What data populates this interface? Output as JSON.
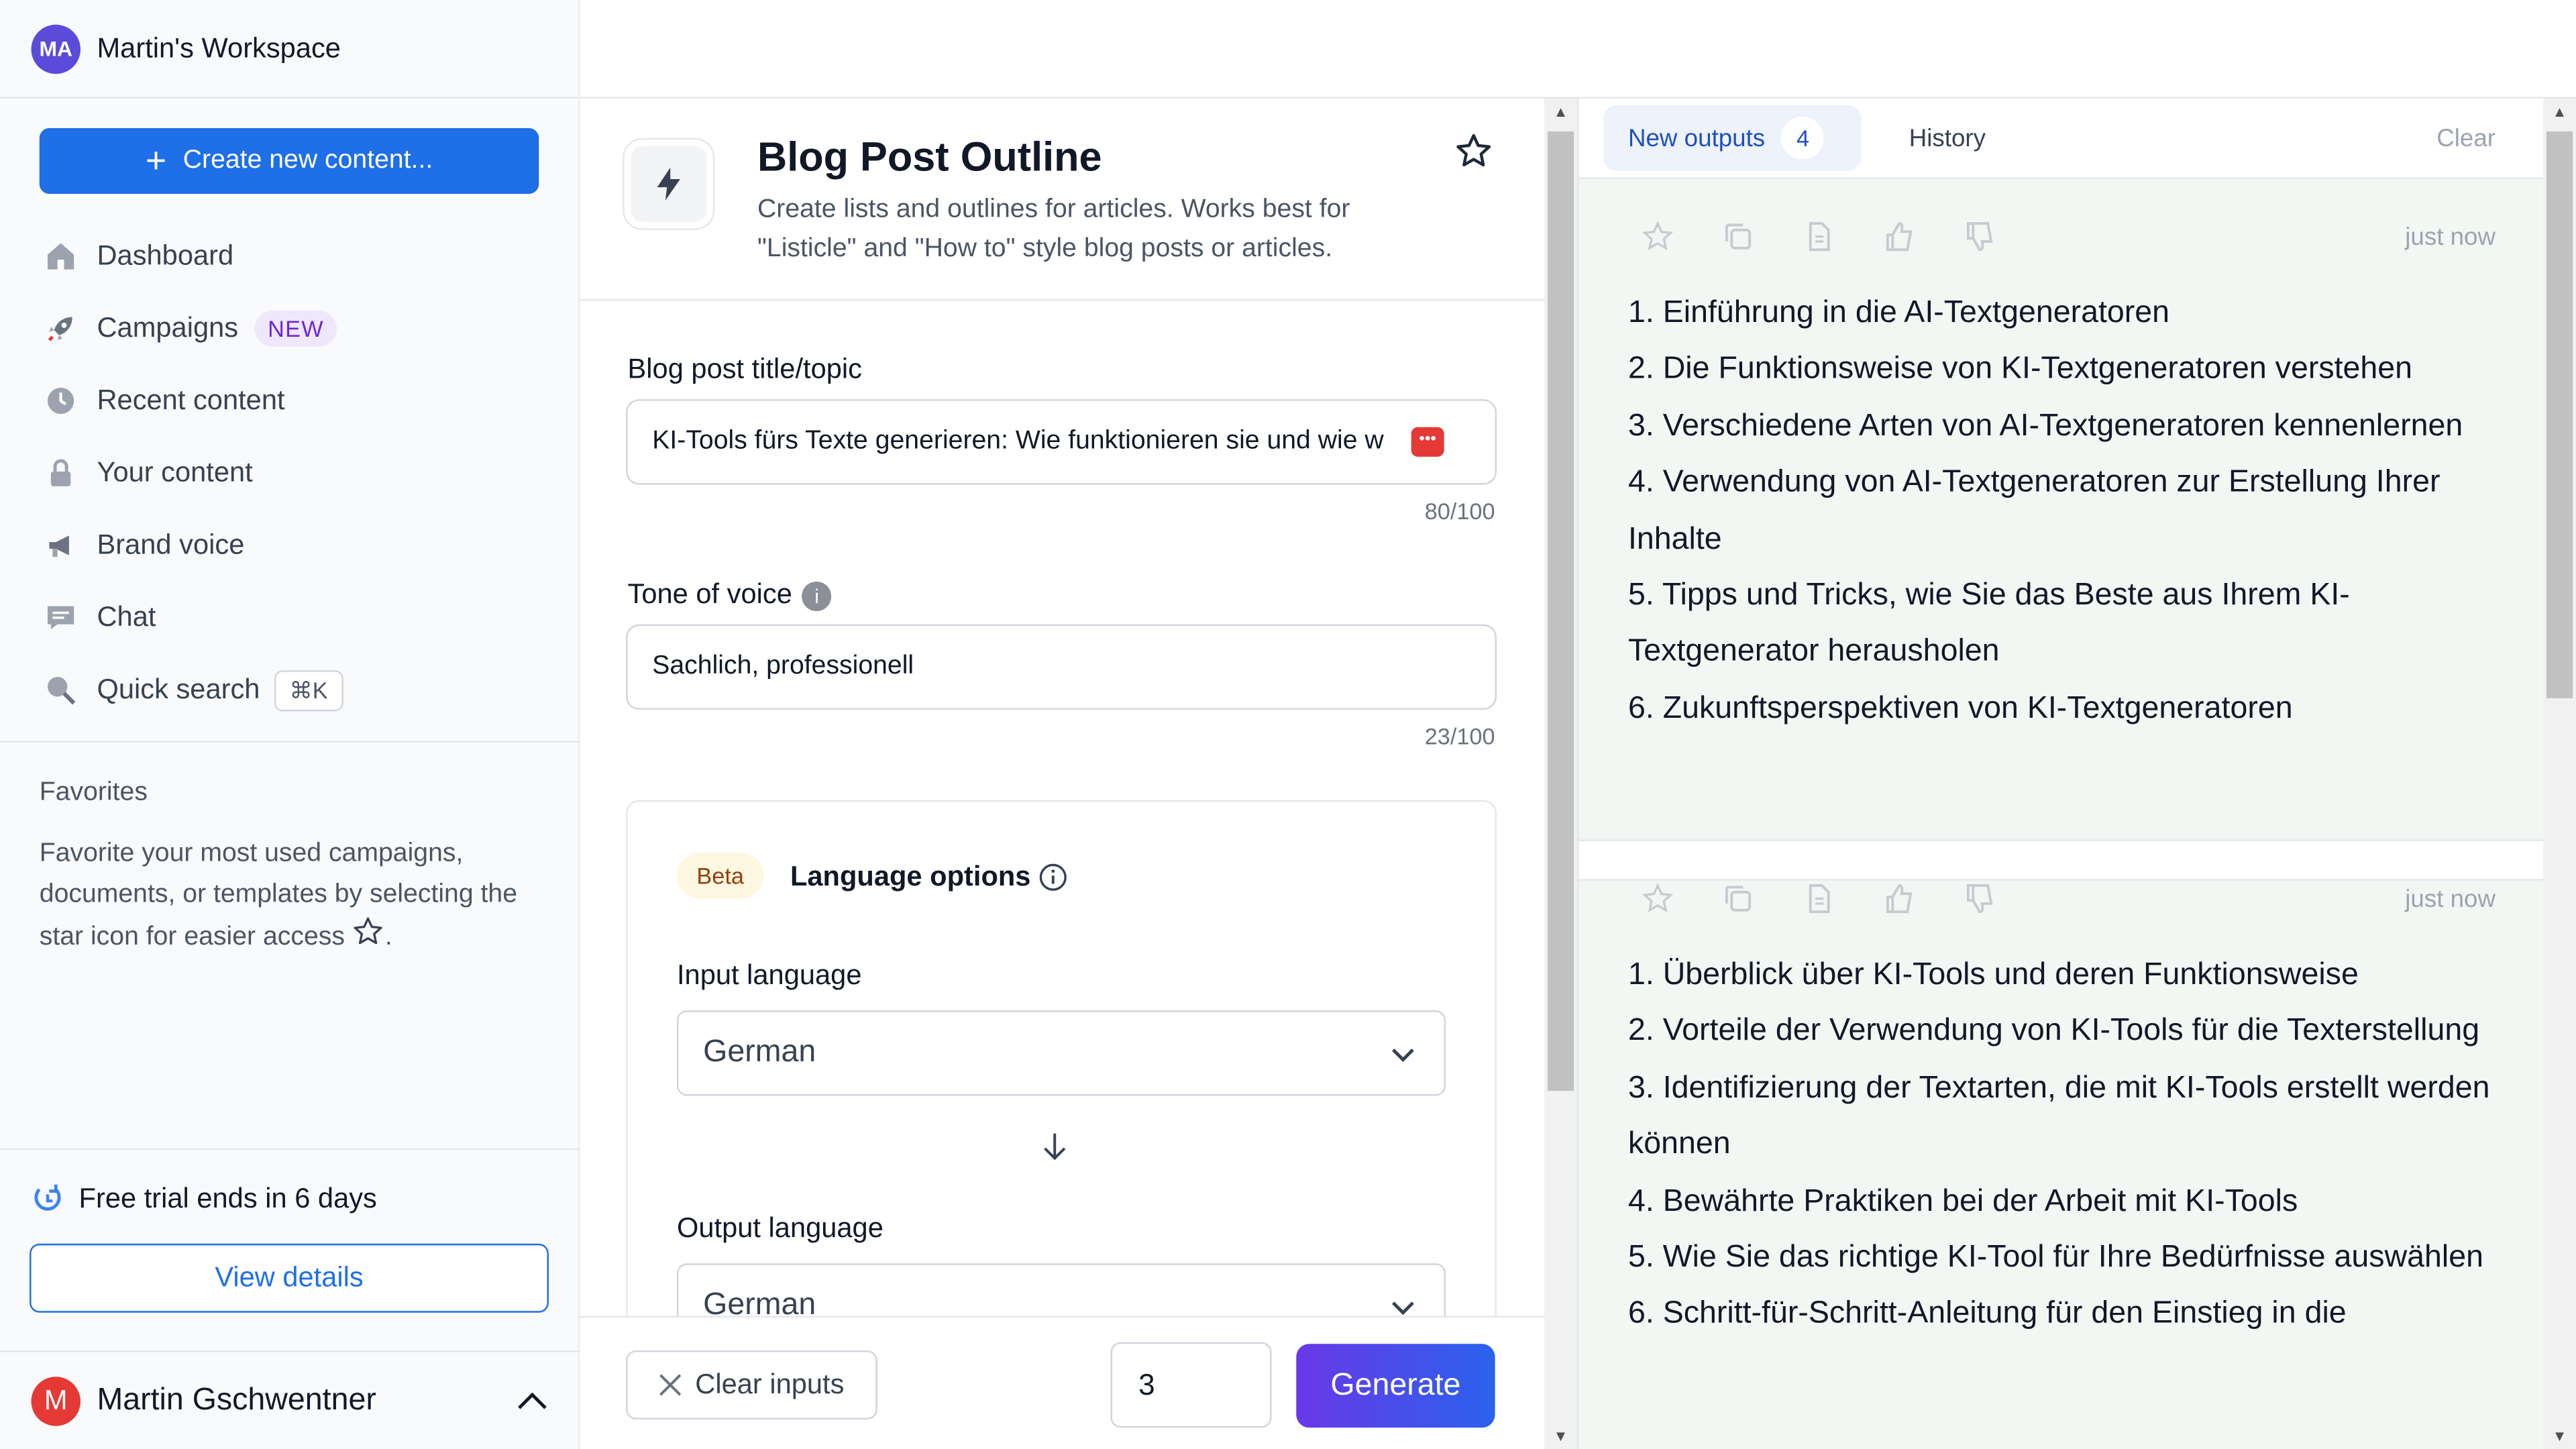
{
  "workspace": {
    "initials": "MA",
    "name": "Martin's Workspace"
  },
  "sidebar": {
    "create_label": "Create new content...",
    "items": [
      {
        "label": "Dashboard",
        "icon": "home-icon"
      },
      {
        "label": "Campaigns",
        "icon": "rocket-icon",
        "badge": "NEW"
      },
      {
        "label": "Recent content",
        "icon": "clock-icon"
      },
      {
        "label": "Your content",
        "icon": "lock-icon"
      },
      {
        "label": "Brand voice",
        "icon": "megaphone-icon"
      },
      {
        "label": "Chat",
        "icon": "chat-icon"
      },
      {
        "label": "Quick search",
        "icon": "search-icon",
        "shortcut": "⌘K"
      }
    ],
    "favorites_title": "Favorites",
    "favorites_text": "Favorite your most used campaigns, documents, or templates by selecting the star icon for easier access",
    "trial_text": "Free trial ends in 6 days",
    "view_details": "View details",
    "user": {
      "initial": "M",
      "name": "Martin Gschwentner"
    }
  },
  "template": {
    "title": "Blog Post Outline",
    "description": "Create lists and outlines for articles. Works best for \"Listicle\" and \"How to\" style blog posts or articles.",
    "topic_label": "Blog post title/topic",
    "topic_value": "KI-Tools fürs Texte generieren: Wie funktionieren sie und wie w",
    "topic_counter": "80/100",
    "tone_label": "Tone of voice",
    "tone_value": "Sachlich, professionell",
    "tone_counter": "23/100",
    "beta": "Beta",
    "lang_title": "Language options",
    "input_lang_label": "Input language",
    "input_lang": "German",
    "output_lang_label": "Output language",
    "output_lang": "German",
    "clear_label": "Clear inputs",
    "count": "3",
    "generate_label": "Generate"
  },
  "outputs": {
    "tab_new": "New outputs",
    "tab_new_count": "4",
    "tab_history": "History",
    "clear": "Clear",
    "cards": [
      {
        "time": "just now",
        "lines": [
          "1. Einführung in die AI-Textgeneratoren",
          "2. Die Funktionsweise von KI-Textgeneratoren verstehen",
          "3. Verschiedene Arten von AI-Textgeneratoren kennenlernen",
          "4. Verwendung von AI-Textgeneratoren zur Erstellung Ihrer Inhalte",
          "5. Tipps und Tricks, wie Sie das Beste aus Ihrem KI-Textgenerator herausholen",
          "6. Zukunftsperspektiven von KI-Textgeneratoren"
        ]
      },
      {
        "time": "just now",
        "lines": [
          "1. Überblick über KI-Tools und deren Funktionsweise",
          "2. Vorteile der Verwendung von KI-Tools für die Texterstellung",
          "3. Identifizierung der Textarten, die mit KI-Tools erstellt werden können",
          "4. Bewährte Praktiken bei der Arbeit mit KI-Tools",
          "5. Wie Sie das richtige KI-Tool für Ihre Bedürfnisse auswählen",
          "6. Schritt-für-Schritt-Anleitung für den Einstieg in die"
        ]
      }
    ]
  },
  "colors": {
    "primary": "#1f6fe6",
    "accent_purple": "#6a38e8",
    "output_bg": "#f2f7f3"
  }
}
